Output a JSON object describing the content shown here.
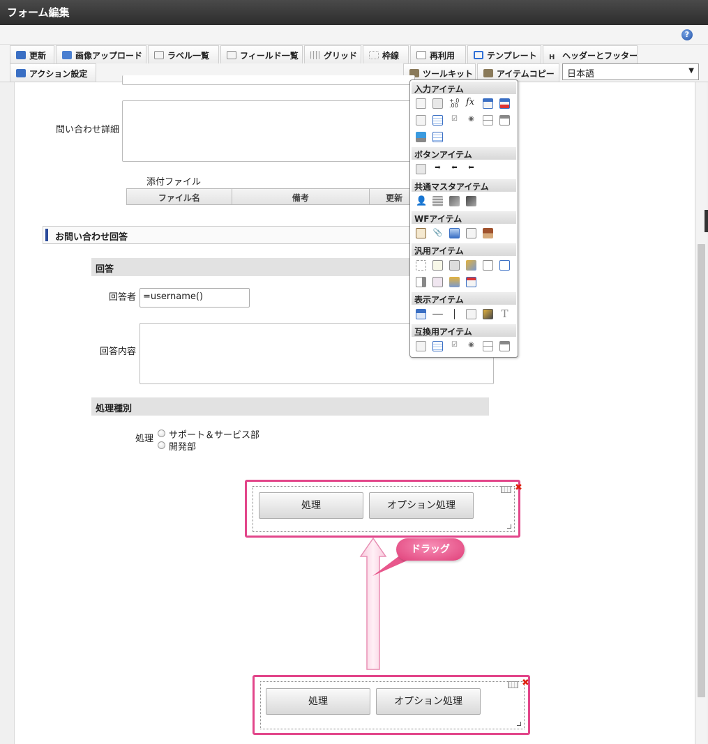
{
  "window": {
    "title": "フォーム編集"
  },
  "help": {
    "icon": "help-icon",
    "label": "?"
  },
  "toolbar": {
    "tabs": [
      {
        "label": "更新",
        "icon": "update-icon",
        "color": "#3a6fc4"
      },
      {
        "label": "画像アップロード",
        "icon": "image-upload-icon",
        "color": "#4a7fd0"
      },
      {
        "label": "ラベル一覧",
        "icon": "label-list-icon",
        "color": "#8c8c8c"
      },
      {
        "label": "フィールド一覧",
        "icon": "field-list-icon",
        "color": "#8c8c8c"
      },
      {
        "label": "グリッド",
        "icon": "grid-icon",
        "color": "#a0a0a0"
      },
      {
        "label": "枠線",
        "icon": "border-icon",
        "color": "#a0a0a0"
      },
      {
        "label": "再利用",
        "icon": "reuse-icon",
        "color": "#888888"
      },
      {
        "label": "テンプレート",
        "icon": "template-icon",
        "color": "#2f6fd6"
      },
      {
        "label": "ヘッダーとフッター",
        "icon": "header-footer-icon",
        "color": "#333333"
      }
    ],
    "row2": [
      {
        "label": "アクション設定",
        "icon": "action-settings-icon",
        "color": "#3a6fc4"
      },
      {
        "label": "ツールキット",
        "icon": "toolkit-icon",
        "color": "#8a7a5a"
      },
      {
        "label": "アイテムコピー",
        "icon": "item-copy-icon",
        "color": "#8a7a5a"
      }
    ],
    "language": "日本語",
    "language_arrow": "▼"
  },
  "form": {
    "inquiry_detail_label": "問い合わせ詳細",
    "attachment_label": "添付ファイル",
    "file_table": {
      "columns": [
        "ファイル名",
        "備考",
        "更新"
      ]
    },
    "section_title": "お問い合わせ回答",
    "answer_head": "回答",
    "responder_label": "回答者",
    "responder_value": "=username()",
    "answer_content_label": "回答内容",
    "process_type_head": "処理種別",
    "process_label": "処理",
    "process_options": [
      "サポート＆サービス部",
      "開発部"
    ]
  },
  "button_blocks": {
    "process_button": "処理",
    "option_button": "オプション処理",
    "close_glyph": "✖"
  },
  "annotation": {
    "drag_label": "ドラッグ",
    "accent": "#e2468a"
  },
  "toolkit": {
    "sections": [
      {
        "title": "入力アイテム"
      },
      {
        "title": "ボタンアイテム"
      },
      {
        "title": "共通マスタアイテム"
      },
      {
        "title": "WFアイテム"
      },
      {
        "title": "汎用アイテム"
      },
      {
        "title": "表示アイテム"
      },
      {
        "title": "互換用アイテム"
      }
    ],
    "fx_glyph": "fx",
    "text_glyph": "T"
  }
}
